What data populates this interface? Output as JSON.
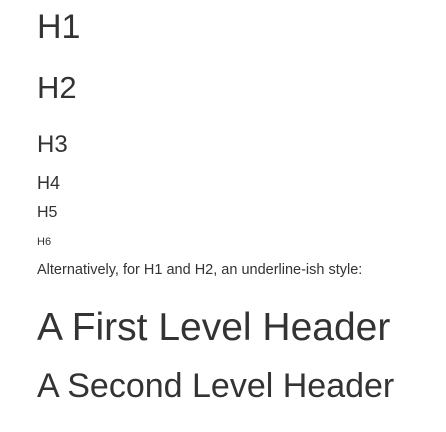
{
  "headers": {
    "h1": "H1",
    "h2": "H2",
    "h3": "H3",
    "h4": "H4",
    "h5": "H5",
    "h6": "H6"
  },
  "paragraph": "Alternatively, for H1 and H2, an underline-ish style:",
  "alt_headers": {
    "first": "A First Level Header",
    "second": "A Second Level Header"
  }
}
